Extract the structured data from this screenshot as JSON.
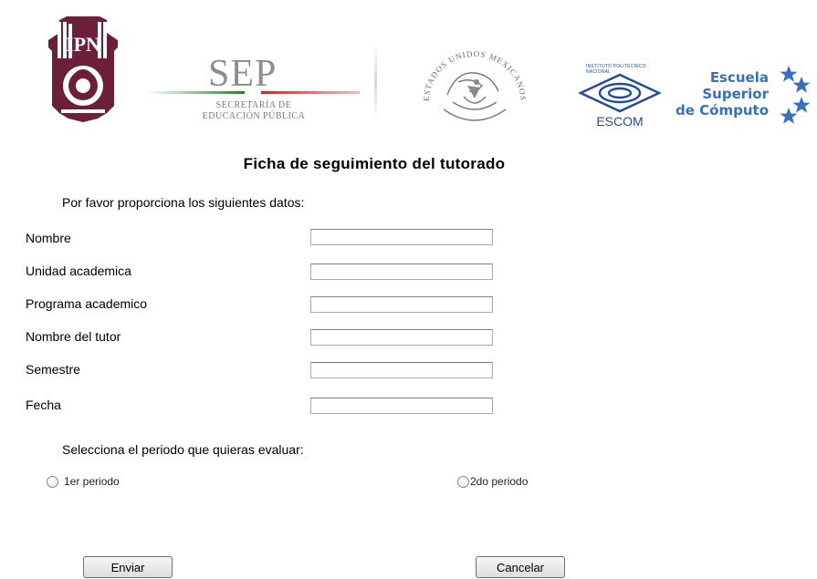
{
  "header": {
    "logos": {
      "ipn": {
        "text": "IPN"
      },
      "sep": {
        "title": "SEP",
        "line1": "SECRETARÍA DE",
        "line2": "EDUCACIÓN PÚBLICA"
      },
      "mexico": {
        "text": "ESTADOS UNIDOS MEXICANOS"
      },
      "escom": {
        "small_text": "INSTITUTO POLITÉCNICO NACIONAL",
        "word": "ESCOM"
      }
    },
    "school_name_lines": [
      "Escuela",
      "Superior",
      "de Cómputo"
    ]
  },
  "form": {
    "title": "Ficha de seguimiento del tutorado",
    "intro": "Por favor proporciona los siguientes datos:",
    "fields": [
      {
        "label": "Nombre",
        "value": ""
      },
      {
        "label": "Unidad academica",
        "value": ""
      },
      {
        "label": "Programa academico",
        "value": ""
      },
      {
        "label": "Nombre del tutor",
        "value": ""
      },
      {
        "label": "Semestre",
        "value": ""
      },
      {
        "label": "Fecha",
        "value": ""
      }
    ],
    "period_prompt": "Selecciona el periodo que quieras evaluar:",
    "periods": [
      {
        "label": "1er periodo",
        "selected": false
      },
      {
        "label": "2do periodo",
        "selected": false
      }
    ],
    "buttons": {
      "submit": "Enviar",
      "cancel": "Cancelar"
    }
  },
  "colors": {
    "ipn_maroon": "#6b1f3a",
    "sep_gray": "#8e8e8e",
    "sep_green": "#2e7d32",
    "sep_red": "#c62828",
    "escom_blue": "#1f4aa3",
    "escuela_blue": "#3670c0"
  }
}
